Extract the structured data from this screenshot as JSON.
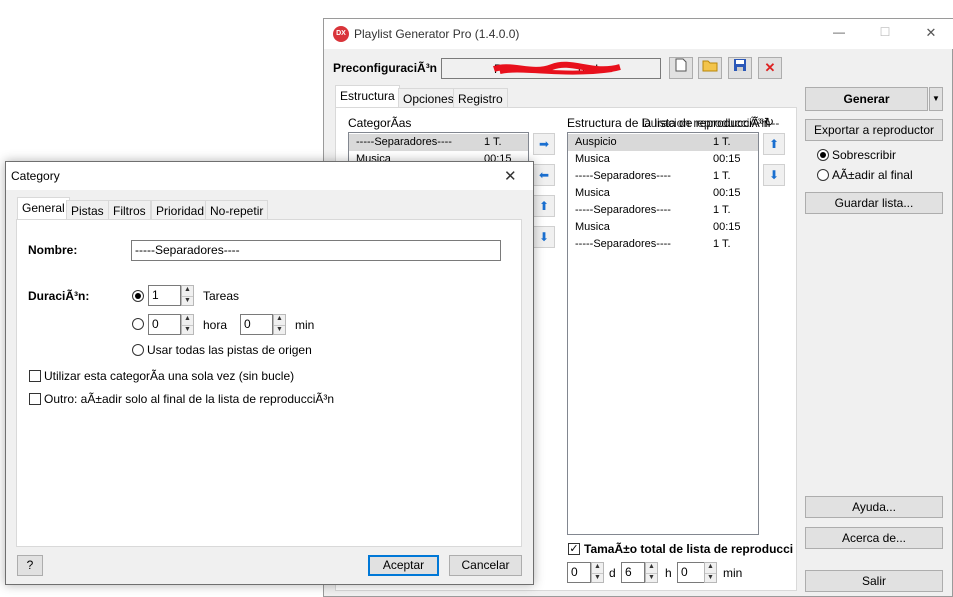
{
  "main": {
    "title": "Playlist Generator Pro (1.4.0.0)",
    "logo": "DX",
    "preset_label": "PreconfiguraciÃ³n",
    "preset_value": "P",
    "preset_value_tail": "bado",
    "tabs": [
      "Estructura",
      "Opciones",
      "Registro"
    ],
    "categories_label": "CategorÃ­as",
    "categories": [
      {
        "name": "-----Separadores----",
        "dur": "1 T."
      },
      {
        "name": "Musica",
        "dur": "00:15"
      }
    ],
    "structure_label": "Estructura de la lista de reproducciÃ³n",
    "structure_overlap": "Duracion reproducciÃ³n --",
    "structure": [
      {
        "name": "Auspicio",
        "dur": "1 T."
      },
      {
        "name": "Musica",
        "dur": "00:15"
      },
      {
        "name": "-----Separadores----",
        "dur": "1 T."
      },
      {
        "name": "Musica",
        "dur": "00:15"
      },
      {
        "name": "-----Separadores----",
        "dur": "1 T."
      },
      {
        "name": "Musica",
        "dur": "00:15"
      },
      {
        "name": "-----Separadores----",
        "dur": "1 T."
      }
    ],
    "total_size_label": "TamaÃ±o total de lista de reproducci",
    "total_d": "0",
    "d_label": "d",
    "total_h": "6",
    "h_label": "h",
    "total_min": "0",
    "min_label": "min",
    "generate": "Generar",
    "export": "Exportar a reproductor",
    "overwrite": "Sobrescribir",
    "append": "AÃ±adir al final",
    "save_list": "Guardar lista...",
    "help": "Ayuda...",
    "about": "Acerca de...",
    "exit": "Salir",
    "window_controls": {
      "minimize": "—",
      "maximize": "☐",
      "close": "✕"
    },
    "colors": {
      "accent": "#0078d7",
      "selected_row": "#d9d9d9",
      "logo_red": "#d9343a",
      "scribble": "#e8101c"
    }
  },
  "dialog": {
    "title": "Category",
    "close": "✕",
    "tabs": [
      "General",
      "Pistas",
      "Filtros",
      "Prioridad",
      "No-repetir"
    ],
    "name_label": "Nombre:",
    "name_value": "-----Separadores----",
    "duration_label": "DuraciÃ³n:",
    "tasks_value": "1",
    "tasks_label": "Tareas",
    "hours_value": "0",
    "hours_label": "hora",
    "min_value": "0",
    "min_label": "min",
    "use_all_label": "Usar todas las pistas de origen",
    "once_label": "Utilizar esta categorÃ­a una sola vez (sin bucle)",
    "outro_label": "Outro: aÃ±adir solo al final de la lista de reproducciÃ³n",
    "help": "?",
    "accept": "Aceptar",
    "cancel": "Cancelar"
  }
}
